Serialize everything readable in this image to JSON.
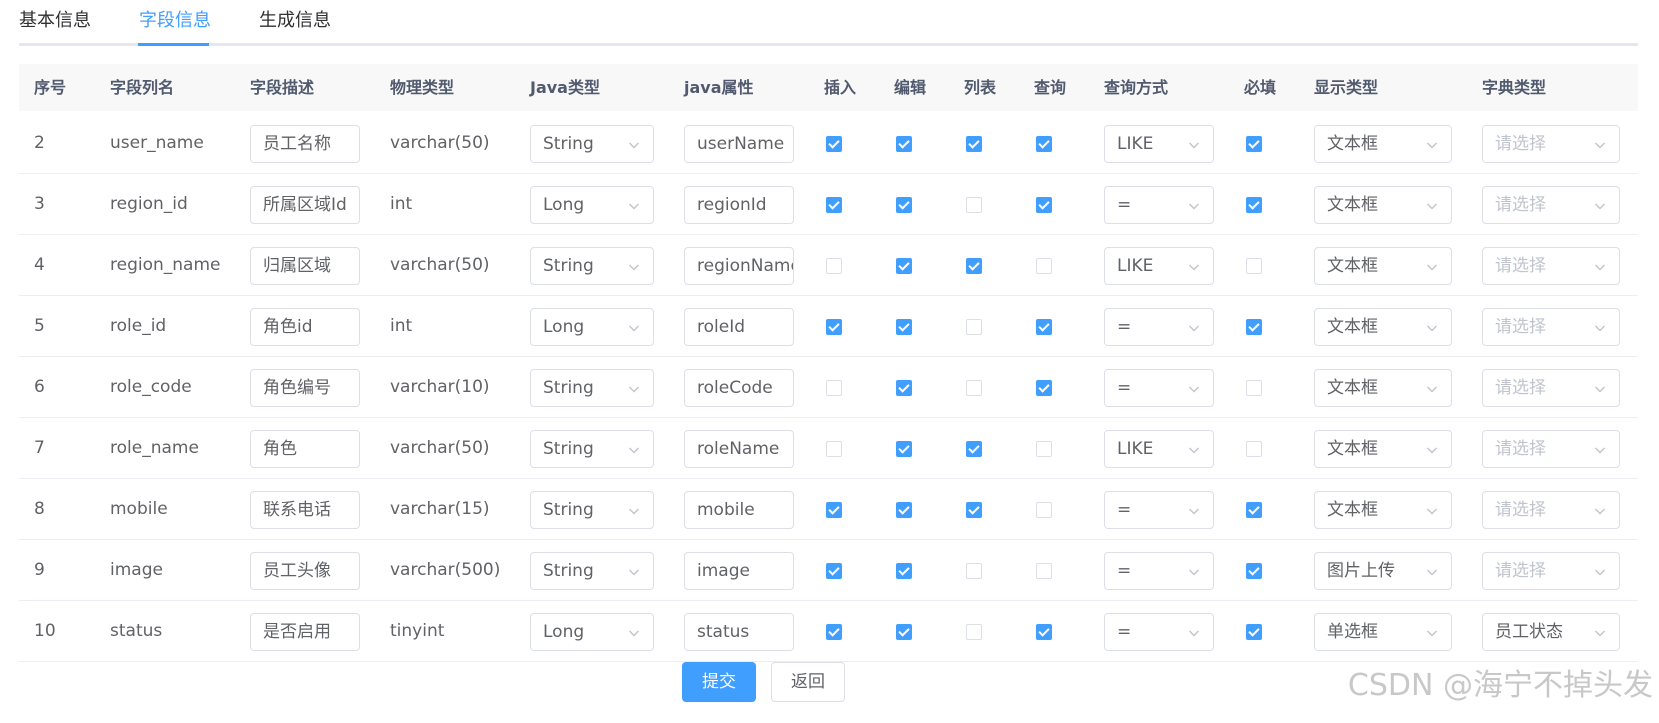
{
  "tabs": [
    {
      "label": "基本信息",
      "active": false
    },
    {
      "label": "字段信息",
      "active": true
    },
    {
      "label": "生成信息",
      "active": false
    }
  ],
  "columns": [
    "序号",
    "字段列名",
    "字段描述",
    "物理类型",
    "Java类型",
    "java属性",
    "插入",
    "编辑",
    "列表",
    "查询",
    "查询方式",
    "必填",
    "显示类型",
    "字典类型"
  ],
  "dict_placeholder": "请选择",
  "rows": [
    {
      "index": "2",
      "column": "user_name",
      "desc": "员工名称",
      "physical": "varchar(50)",
      "java_type": "String",
      "java_attr": "userName",
      "insert": true,
      "edit": true,
      "list": true,
      "query": true,
      "query_type": "LIKE",
      "required": true,
      "display": "文本框",
      "dict": ""
    },
    {
      "index": "3",
      "column": "region_id",
      "desc": "所属区域Id",
      "physical": "int",
      "java_type": "Long",
      "java_attr": "regionId",
      "insert": true,
      "edit": true,
      "list": false,
      "query": true,
      "query_type": "=",
      "required": true,
      "display": "文本框",
      "dict": ""
    },
    {
      "index": "4",
      "column": "region_name",
      "desc": "归属区域",
      "physical": "varchar(50)",
      "java_type": "String",
      "java_attr": "regionName",
      "insert": false,
      "edit": true,
      "list": true,
      "query": false,
      "query_type": "LIKE",
      "required": false,
      "display": "文本框",
      "dict": ""
    },
    {
      "index": "5",
      "column": "role_id",
      "desc": "角色id",
      "physical": "int",
      "java_type": "Long",
      "java_attr": "roleId",
      "insert": true,
      "edit": true,
      "list": false,
      "query": true,
      "query_type": "=",
      "required": true,
      "display": "文本框",
      "dict": ""
    },
    {
      "index": "6",
      "column": "role_code",
      "desc": "角色编号",
      "physical": "varchar(10)",
      "java_type": "String",
      "java_attr": "roleCode",
      "insert": false,
      "edit": true,
      "list": false,
      "query": true,
      "query_type": "=",
      "required": false,
      "display": "文本框",
      "dict": ""
    },
    {
      "index": "7",
      "column": "role_name",
      "desc": "角色",
      "physical": "varchar(50)",
      "java_type": "String",
      "java_attr": "roleName",
      "insert": false,
      "edit": true,
      "list": true,
      "query": false,
      "query_type": "LIKE",
      "required": false,
      "display": "文本框",
      "dict": ""
    },
    {
      "index": "8",
      "column": "mobile",
      "desc": "联系电话",
      "physical": "varchar(15)",
      "java_type": "String",
      "java_attr": "mobile",
      "insert": true,
      "edit": true,
      "list": true,
      "query": false,
      "query_type": "=",
      "required": true,
      "display": "文本框",
      "dict": ""
    },
    {
      "index": "9",
      "column": "image",
      "desc": "员工头像",
      "physical": "varchar(500)",
      "java_type": "String",
      "java_attr": "image",
      "insert": true,
      "edit": true,
      "list": false,
      "query": false,
      "query_type": "=",
      "required": true,
      "display": "图片上传",
      "dict": ""
    },
    {
      "index": "10",
      "column": "status",
      "desc": "是否启用",
      "physical": "tinyint",
      "java_type": "Long",
      "java_attr": "status",
      "insert": true,
      "edit": true,
      "list": false,
      "query": true,
      "query_type": "=",
      "required": true,
      "display": "单选框",
      "dict": "员工状态"
    }
  ],
  "actions": {
    "submit": "提交",
    "back": "返回"
  },
  "watermark": "CSDN @海宁不掉头发",
  "colors": {
    "primary": "#409eff",
    "border": "#dcdfe6",
    "header_bg": "#f8f8f9",
    "text": "#606266"
  }
}
